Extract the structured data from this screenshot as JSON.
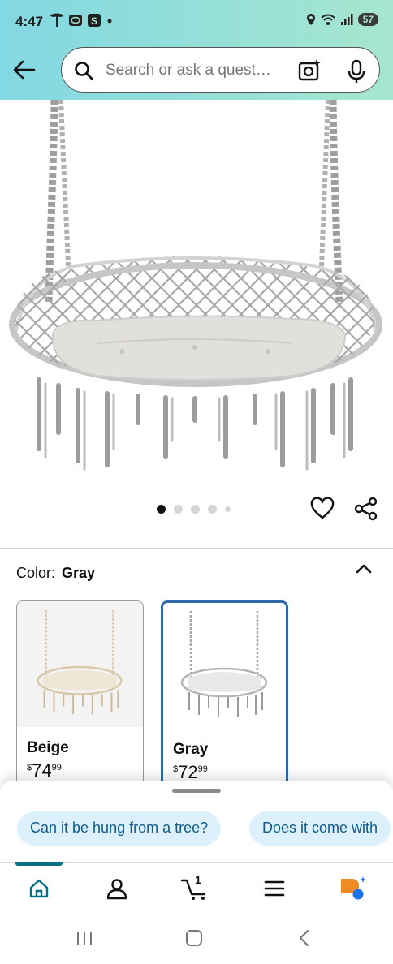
{
  "status_bar": {
    "time": "4:47",
    "left_icons": [
      "tesla-icon",
      "toyota-icon",
      "s-app-icon",
      "dot-icon"
    ],
    "right_icons": [
      "location-icon",
      "wifi-icon",
      "signal-icon"
    ],
    "battery": "57"
  },
  "search": {
    "placeholder": "Search or ask a quest…"
  },
  "product": {
    "image_alt": "Gray hanging hammock chair",
    "carousel_page": 1,
    "carousel_total": 5
  },
  "color_selector": {
    "label": "Color:",
    "selected": "Gray",
    "options": [
      {
        "name": "Beige",
        "currency": "$",
        "whole": "74",
        "fraction": "99"
      },
      {
        "name": "Gray",
        "currency": "$",
        "whole": "72",
        "fraction": "99"
      }
    ]
  },
  "suggestions": {
    "chips": [
      "Can it be hung from a tree?",
      "Does it come with"
    ]
  },
  "cart": {
    "count": "1"
  },
  "colors": {
    "header_start": "#82d8e3",
    "header_end": "#a6e6ce",
    "accent_teal": "#007185",
    "selected_border": "#2e6aa8",
    "chip_bg": "#dcf1fb",
    "rufus_orange": "#f08a24",
    "rufus_blue": "#1a73e8"
  }
}
